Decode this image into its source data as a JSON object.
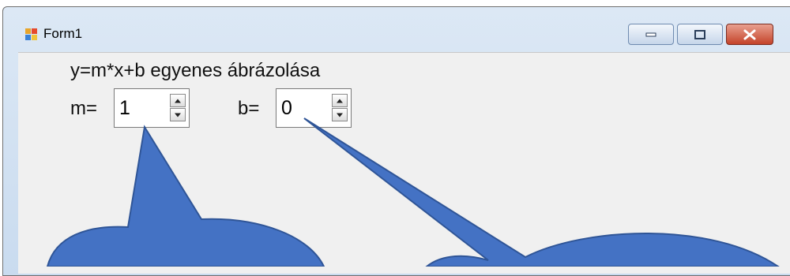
{
  "window": {
    "title": "Form1",
    "icon": "windows-form-icon",
    "controls": [
      "minimize-icon",
      "maximize-icon",
      "close-icon"
    ]
  },
  "form": {
    "heading": "y=m*x+b egyenes ábrázolása",
    "m_label": "m=",
    "m_value": "1",
    "b_label": "b=",
    "b_value": "0"
  },
  "callouts": {
    "fill": "#4472c4",
    "stroke": "#2f5597"
  }
}
